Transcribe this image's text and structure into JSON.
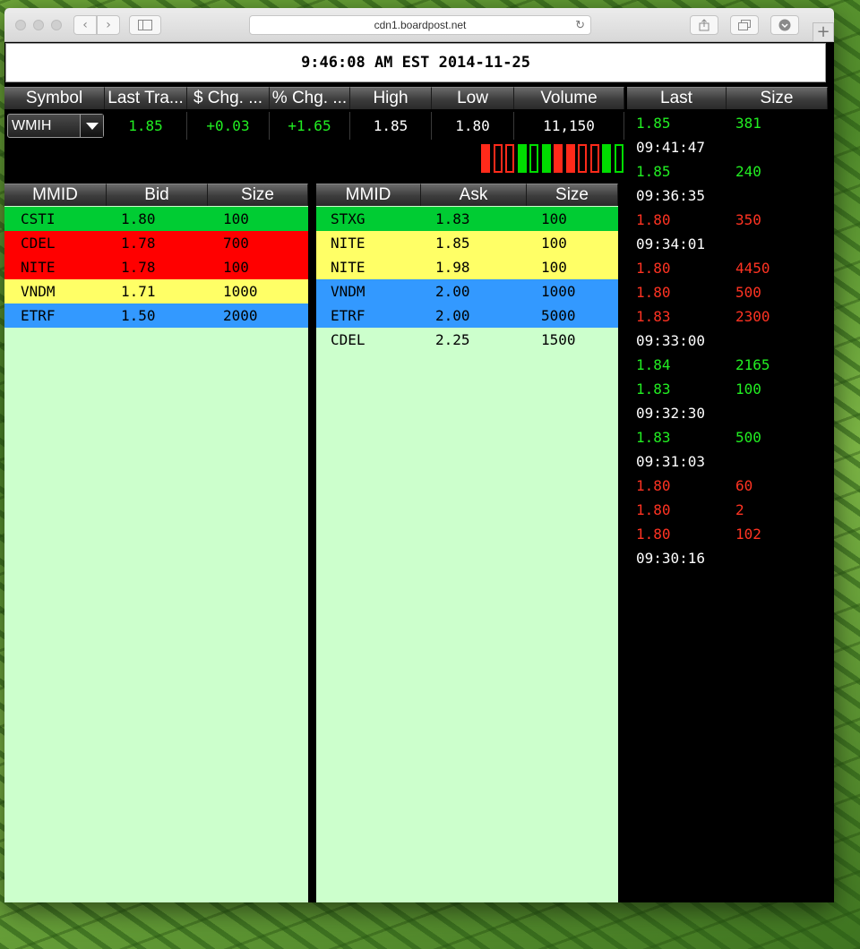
{
  "browser": {
    "url": "cdn1.boardpost.net",
    "back_icon": "chevron-left-icon",
    "forward_icon": "chevron-right-icon",
    "sidebar_icon": "sidebar-icon",
    "reload_icon": "reload-icon",
    "share_icon": "share-icon",
    "tabs_icon": "tabs-icon",
    "download_icon": "download-icon",
    "new_tab_label": "+"
  },
  "clock": "9:46:08 AM EST 2014-11-25",
  "quote": {
    "headers": [
      "Symbol",
      "Last Tra...",
      "$ Chg. ...",
      "% Chg. ...",
      "High",
      "Low",
      "Volume"
    ],
    "symbol": "WMIH",
    "last": "1.85",
    "dchg": "+0.03",
    "pchg": "+1.65",
    "high": "1.85",
    "low": "1.80",
    "volume": "11,150"
  },
  "tick_bars": [
    {
      "color": "#ff2a1a",
      "filled": true
    },
    {
      "color": "#ff2a1a",
      "filled": false
    },
    {
      "color": "#ff2a1a",
      "filled": false
    },
    {
      "color": "#00dd00",
      "filled": true
    },
    {
      "color": "#00dd00",
      "filled": false
    },
    {
      "color": "#00dd00",
      "filled": true
    },
    {
      "color": "#ff2a1a",
      "filled": true
    },
    {
      "color": "#ff2a1a",
      "filled": true
    },
    {
      "color": "#ff2a1a",
      "filled": false
    },
    {
      "color": "#ff2a1a",
      "filled": false
    },
    {
      "color": "#00dd00",
      "filled": true
    },
    {
      "color": "#00dd00",
      "filled": false
    }
  ],
  "bid": {
    "headers": [
      "MMID",
      "Bid",
      "Size"
    ],
    "rows": [
      {
        "mmid": "CSTI",
        "price": "1.80",
        "size": "100",
        "bg": "#00cc33"
      },
      {
        "mmid": "CDEL",
        "price": "1.78",
        "size": "700",
        "bg": "#ff0000"
      },
      {
        "mmid": "NITE",
        "price": "1.78",
        "size": "100",
        "bg": "#ff0000"
      },
      {
        "mmid": "VNDM",
        "price": "1.71",
        "size": "1000",
        "bg": "#ffff66"
      },
      {
        "mmid": "ETRF",
        "price": "1.50",
        "size": "2000",
        "bg": "#3399ff"
      }
    ]
  },
  "ask": {
    "headers": [
      "MMID",
      "Ask",
      "Size"
    ],
    "rows": [
      {
        "mmid": "STXG",
        "price": "1.83",
        "size": "100",
        "bg": "#00cc33"
      },
      {
        "mmid": "NITE",
        "price": "1.85",
        "size": "100",
        "bg": "#ffff66"
      },
      {
        "mmid": "NITE",
        "price": "1.98",
        "size": "100",
        "bg": "#ffff66"
      },
      {
        "mmid": "VNDM",
        "price": "2.00",
        "size": "1000",
        "bg": "#3399ff"
      },
      {
        "mmid": "ETRF",
        "price": "2.00",
        "size": "5000",
        "bg": "#3399ff"
      },
      {
        "mmid": "CDEL",
        "price": "2.25",
        "size": "1500",
        "bg": "#ccffcc"
      }
    ]
  },
  "trades": {
    "headers": [
      "Last",
      "Size"
    ],
    "rows": [
      {
        "price": "1.85",
        "size": "381",
        "color": "#22ee22"
      },
      {
        "time": "09:41:47"
      },
      {
        "price": "1.85",
        "size": "240",
        "color": "#22ee22"
      },
      {
        "time": "09:36:35"
      },
      {
        "price": "1.80",
        "size": "350",
        "color": "#ff3322"
      },
      {
        "time": "09:34:01"
      },
      {
        "price": "1.80",
        "size": "4450",
        "color": "#ff3322"
      },
      {
        "price": "1.80",
        "size": "500",
        "color": "#ff3322"
      },
      {
        "price": "1.83",
        "size": "2300",
        "color": "#ff3322"
      },
      {
        "time": "09:33:00"
      },
      {
        "price": "1.84",
        "size": "2165",
        "color": "#22ee22"
      },
      {
        "price": "1.83",
        "size": "100",
        "color": "#22ee22"
      },
      {
        "time": "09:32:30"
      },
      {
        "price": "1.83",
        "size": "500",
        "color": "#22ee22"
      },
      {
        "time": "09:31:03"
      },
      {
        "price": "1.80",
        "size": "60",
        "color": "#ff3322"
      },
      {
        "price": "1.80",
        "size": "2",
        "color": "#ff3322"
      },
      {
        "price": "1.80",
        "size": "102",
        "color": "#ff3322"
      },
      {
        "time": "09:30:16"
      }
    ]
  }
}
